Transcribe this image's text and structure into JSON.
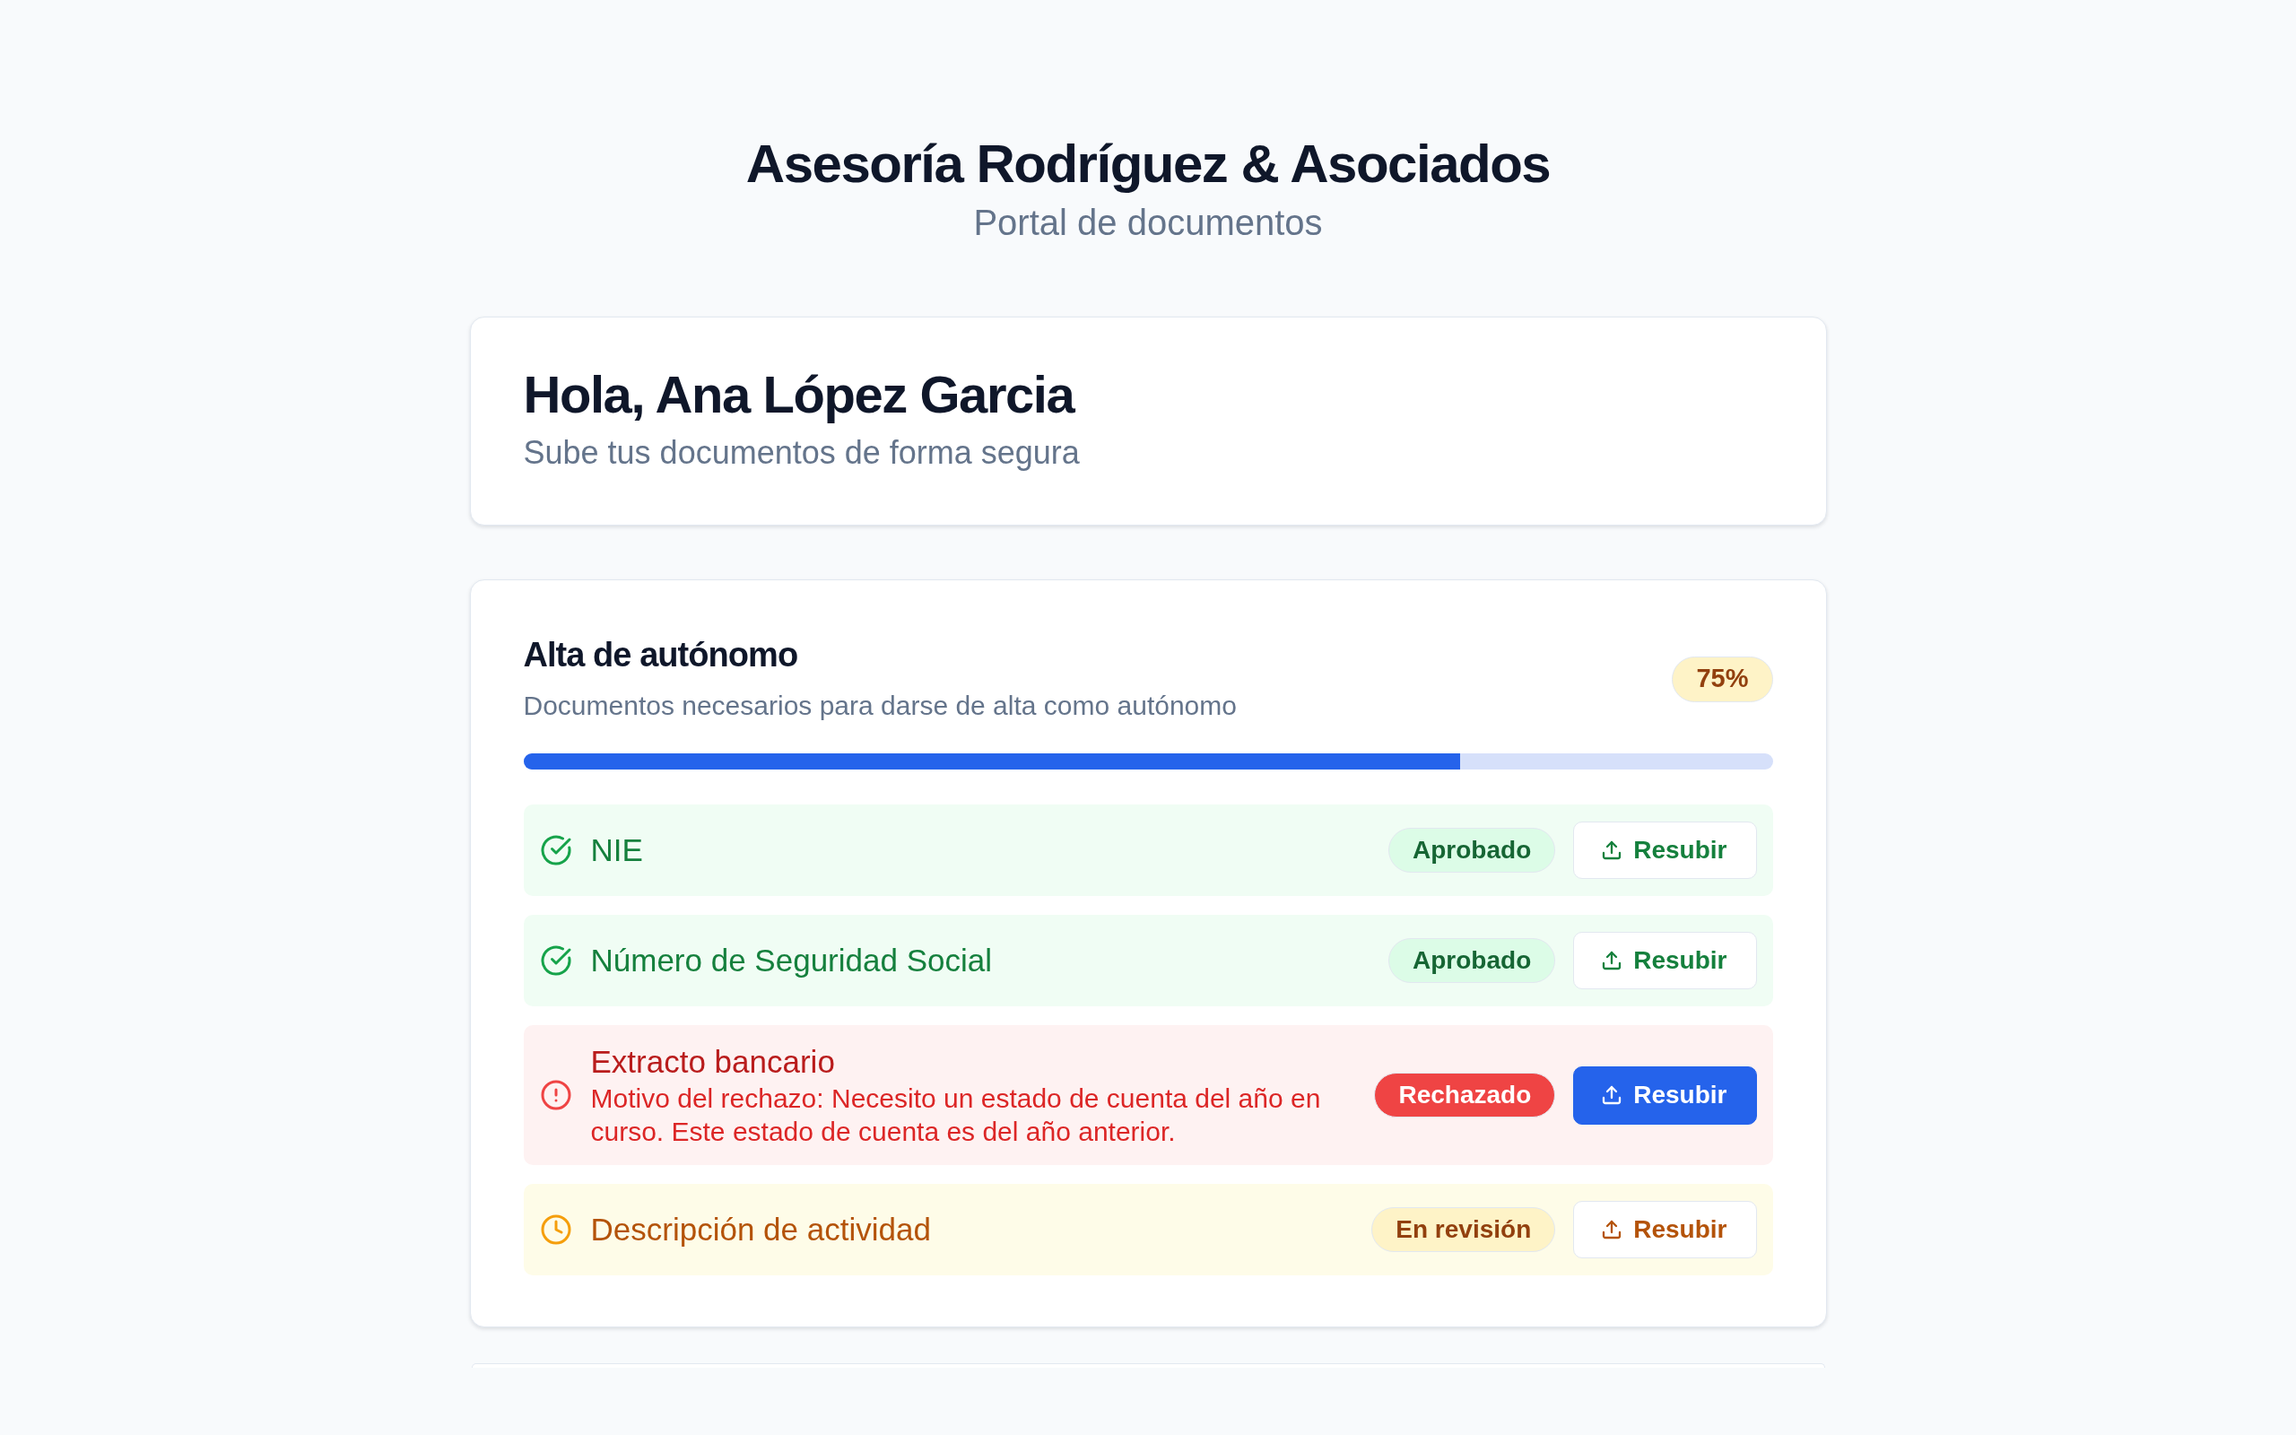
{
  "header": {
    "title": "Asesoría Rodríguez & Asociados",
    "subtitle": "Portal de documentos"
  },
  "welcome": {
    "greeting": "Hola, Ana López Garcia",
    "subtitle": "Sube tus documentos de forma segura"
  },
  "section": {
    "title": "Alta de autónomo",
    "description": "Documentos necesarios para darse de alta como autónomo",
    "progress_label": "75%",
    "level": 0.75,
    "documents": [
      {
        "kind": "approved",
        "name": "NIE",
        "status": "Aprobado",
        "action": "Resubir"
      },
      {
        "kind": "approved",
        "name": "Número de Seguridad Social",
        "status": "Aprobado",
        "action": "Resubir"
      },
      {
        "kind": "rejected",
        "name": "Extracto bancario",
        "reason": "Motivo del rechazo: Necesito un estado de cuenta del año en curso. Este estado de cuenta es del año anterior.",
        "status": "Rechazado",
        "action": "Resubir"
      },
      {
        "kind": "review",
        "name": "Descripción de actividad",
        "status": "En revisión",
        "action": "Resubir"
      }
    ]
  }
}
